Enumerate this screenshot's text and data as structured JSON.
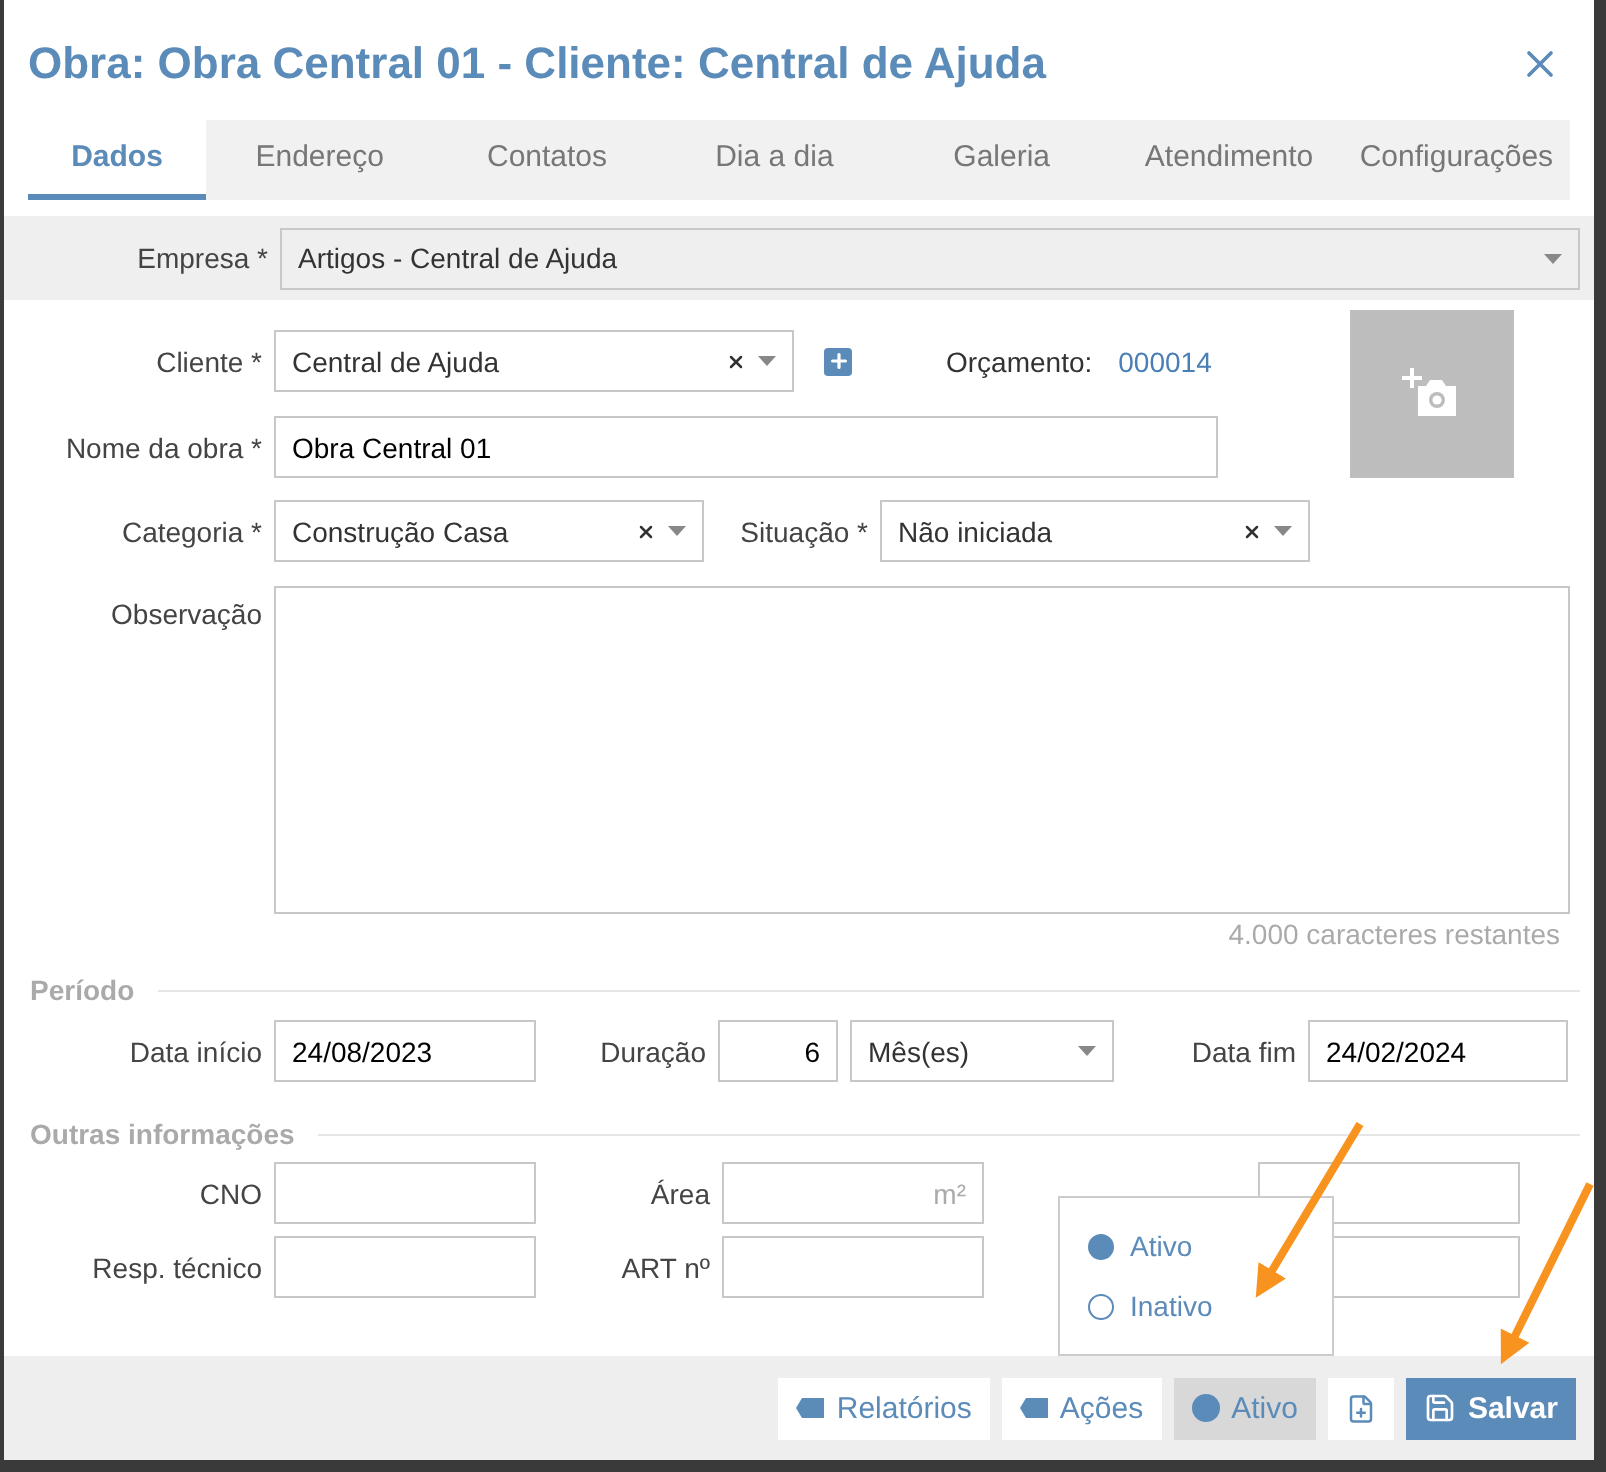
{
  "title": "Obra: Obra Central 01 - Cliente: Central de Ajuda",
  "tabs": [
    {
      "label": "Dados",
      "selected": true
    },
    {
      "label": "Endereço",
      "selected": false
    },
    {
      "label": "Contatos",
      "selected": false
    },
    {
      "label": "Dia a dia",
      "selected": false
    },
    {
      "label": "Galeria",
      "selected": false
    },
    {
      "label": "Atendimento",
      "selected": false
    },
    {
      "label": "Configurações",
      "selected": false
    }
  ],
  "empresa": {
    "label": "Empresa *",
    "value": "Artigos - Central de Ajuda"
  },
  "cliente": {
    "label": "Cliente *",
    "value": "Central de Ajuda"
  },
  "orcamento": {
    "label": "Orçamento:",
    "value": "000014"
  },
  "nome_obra": {
    "label": "Nome da obra *",
    "value": "Obra Central 01"
  },
  "categoria": {
    "label": "Categoria *",
    "value": "Construção Casa"
  },
  "situacao": {
    "label": "Situação *",
    "value": "Não iniciada"
  },
  "observacao": {
    "label": "Observação",
    "counter": "4.000  caracteres restantes"
  },
  "periodo": {
    "heading": "Período",
    "data_inicio": {
      "label": "Data início",
      "value": "24/08/2023"
    },
    "duracao": {
      "label": "Duração",
      "value": "6",
      "unit": "Mês(es)"
    },
    "data_fim": {
      "label": "Data fim",
      "value": "24/02/2024"
    }
  },
  "outras": {
    "heading": "Outras informações",
    "cno": {
      "label": "CNO"
    },
    "area": {
      "label": "Área",
      "unit": "m²"
    },
    "resp_tecnico": {
      "label": "Resp. técnico"
    },
    "art": {
      "label": "ART nº"
    }
  },
  "status_menu": [
    {
      "label": "Ativo",
      "selected": true
    },
    {
      "label": "Inativo",
      "selected": false
    }
  ],
  "footer": [
    {
      "kind": "menu",
      "label": "Relatórios"
    },
    {
      "kind": "menu",
      "label": "Ações"
    },
    {
      "kind": "status",
      "label": "Ativo"
    },
    {
      "kind": "add-doc"
    },
    {
      "kind": "save",
      "label": "Salvar"
    }
  ]
}
